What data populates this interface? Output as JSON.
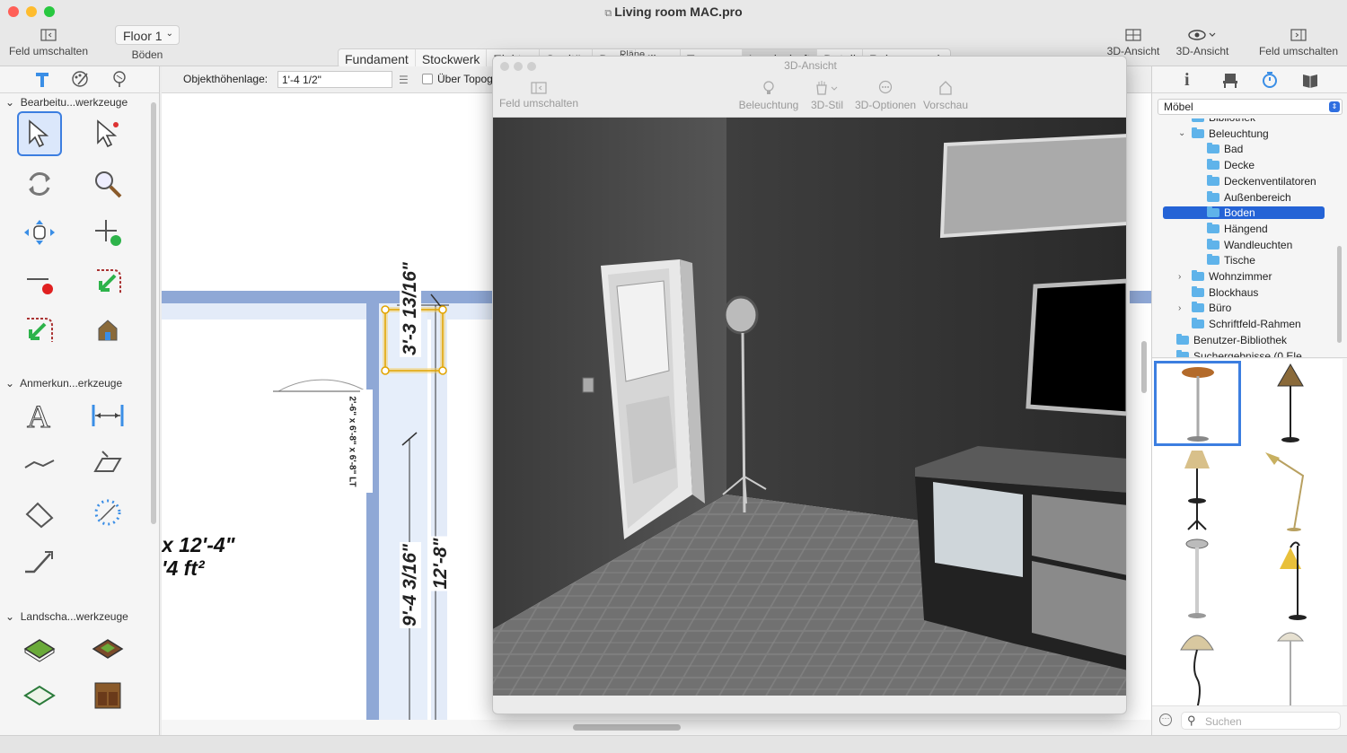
{
  "window": {
    "title": "Living room MAC.pro"
  },
  "toolbar": {
    "left_toggle_label": "Feld umschalten",
    "floor_select": "Floor 1",
    "floor_caption": "Böden",
    "plans": [
      "Fundament",
      "Stockwerk",
      "Elektro",
      "Sanitär",
      "Dach",
      "Klima",
      "Terrasse",
      "Landschaft",
      "Detail",
      "Rahmenwerk"
    ],
    "plans_selected": "Landschaft",
    "plans_caption": "Pläne",
    "view3d_a": "3D-Ansicht",
    "view3d_b": "3D-Ansicht",
    "right_toggle_label": "Feld umschalten"
  },
  "propbar": {
    "height_label": "Objekthöhenlage:",
    "height_value": "1'-4 1/2\"",
    "topo_checkbox_label": "Über Topog"
  },
  "left_panel": {
    "sections": [
      "Bearbeitu...werkzeuge",
      "Anmerkun...erkzeuge",
      "Landscha...werkzeuge"
    ]
  },
  "plan": {
    "room_dim": "x 12'-4\"",
    "room_area": "'4 ft²",
    "dim_1": "3'-3 13/16\"",
    "dim_2": "9'-4 3/16\"",
    "dim_3": "12'-8\"",
    "door_label": "2'-6\" x 6'-8\" x 6'-8\" LT"
  },
  "view3d": {
    "title": "3D-Ansicht",
    "toolbar": [
      "Feld umschalten",
      "Beleuchtung",
      "3D-Stil",
      "3D-Optionen",
      "Vorschau"
    ]
  },
  "right_panel": {
    "library_select": "Möbel",
    "tree": [
      {
        "label": "Bibliothek",
        "indent": 1,
        "chev": ""
      },
      {
        "label": "Beleuchtung",
        "indent": 1,
        "chev": "down"
      },
      {
        "label": "Bad",
        "indent": 2,
        "chev": ""
      },
      {
        "label": "Decke",
        "indent": 2,
        "chev": ""
      },
      {
        "label": "Deckenventilatoren",
        "indent": 2,
        "chev": ""
      },
      {
        "label": "Außenbereich",
        "indent": 2,
        "chev": ""
      },
      {
        "label": "Boden",
        "indent": 2,
        "chev": "",
        "selected": true
      },
      {
        "label": "Hängend",
        "indent": 2,
        "chev": ""
      },
      {
        "label": "Wandleuchten",
        "indent": 2,
        "chev": ""
      },
      {
        "label": "Tische",
        "indent": 2,
        "chev": ""
      },
      {
        "label": "Wohnzimmer",
        "indent": 1,
        "chev": "right"
      },
      {
        "label": "Blockhaus",
        "indent": 1,
        "chev": ""
      },
      {
        "label": "Büro",
        "indent": 1,
        "chev": "right"
      },
      {
        "label": "Schriftfeld-Rahmen",
        "indent": 1,
        "chev": ""
      },
      {
        "label": "Benutzer-Bibliothek",
        "indent": 0,
        "chev": ""
      },
      {
        "label": "Suchergebnisse (0 Ele",
        "indent": 0,
        "chev": ""
      }
    ],
    "search_placeholder": "Suchen"
  },
  "colors": {
    "accent": "#2f6fe0",
    "selection": "#2463d6",
    "plan_wall": "#8fa8d6",
    "dim_highlight": "#e2a400"
  }
}
